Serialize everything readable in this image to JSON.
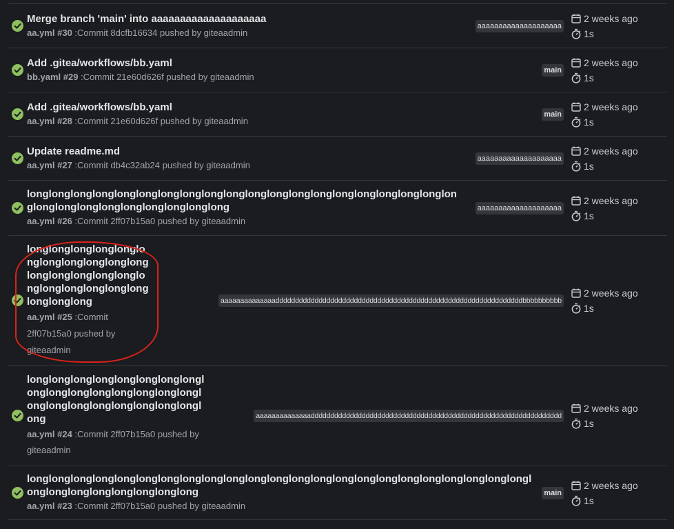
{
  "runs": [
    {
      "title": "Merge branch 'main' into aaaaaaaaaaaaaaaaaaaa",
      "workflow": "aa.yml",
      "number": "#30",
      "commit_text": " :Commit 8dcfb16634 pushed by giteaadmin",
      "branch": "aaaaaaaaaaaaaaaaaaaa",
      "date": "2 weeks ago",
      "duration": "1s"
    },
    {
      "title": "Add .gitea/workflows/bb.yaml",
      "workflow": "bb.yaml",
      "number": "#29",
      "commit_text": " :Commit 21e60d626f pushed by giteaadmin",
      "branch": "main",
      "date": "2 weeks ago",
      "duration": "1s"
    },
    {
      "title": "Add .gitea/workflows/bb.yaml",
      "workflow": "aa.yml",
      "number": "#28",
      "commit_text": " :Commit 21e60d626f pushed by giteaadmin",
      "branch": "main",
      "date": "2 weeks ago",
      "duration": "1s"
    },
    {
      "title": "Update readme.md",
      "workflow": "aa.yml",
      "number": "#27",
      "commit_text": " :Commit db4c32ab24 pushed by giteaadmin",
      "branch": "aaaaaaaaaaaaaaaaaaaa",
      "date": "2 weeks ago",
      "duration": "1s"
    },
    {
      "title": "longlonglonglonglonglonglonglonglonglonglonglonglonglonglonglonglonglonglonglonglonglonglonglonglonglonglonglonglong",
      "workflow": "aa.yml",
      "number": "#26",
      "commit_text": " :Commit 2ff07b15a0 pushed by giteaadmin",
      "branch": "aaaaaaaaaaaaaaaaaaaa",
      "date": "2 weeks ago",
      "duration": "1s"
    },
    {
      "title": "longlonglonglonglonglonglonglonglonglonglonglonglonglonglonglonglonglonglonglonglonglonglonglonglong",
      "workflow": "aa.yml",
      "number": "#25",
      "commit_text": " :Commit 2ff07b15a0 pushed by giteaadmin",
      "branch": "aaaaaaaaaaaaaadddddddddddddddddddddddddddddddddddddddddddddddddddddddddddddddbbbbbbbbbb",
      "date": "2 weeks ago",
      "duration": "1s"
    },
    {
      "title": "longlonglonglonglonglonglonglonglonglonglonglonglonglonglonglonglonglonglonglonglonglonglonglonglong",
      "workflow": "aa.yml",
      "number": "#24",
      "commit_text": " :Commit 2ff07b15a0 pushed by giteaadmin",
      "branch": "aaaaaaaaaaaaaadddddddddddddddddddddddddddddddddddddddddddddddddddddddddddddddd",
      "date": "2 weeks ago",
      "duration": "1s"
    },
    {
      "title": "longlonglonglonglonglonglonglonglonglonglonglonglonglonglonglonglonglonglonglonglonglonglonglonglonglonglonglonglonglonglong",
      "workflow": "aa.yml",
      "number": "#23",
      "commit_text": " :Commit 2ff07b15a0 pushed by giteaadmin",
      "branch": "main",
      "date": "2 weeks ago",
      "duration": "1s"
    }
  ],
  "colors": {
    "success": "#8fbf5f",
    "annotation": "#d9231c",
    "background": "#1b1c1f"
  },
  "icons": {
    "status": "check-circle-icon",
    "date": "calendar-icon",
    "duration": "stopwatch-icon"
  }
}
